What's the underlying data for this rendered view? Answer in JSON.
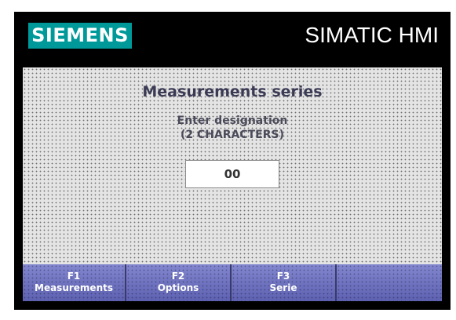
{
  "header": {
    "logo_text": "SIEMENS",
    "product": "SIMATIC HMI"
  },
  "screen": {
    "title": "Measurements series",
    "prompt_line1": "Enter designation",
    "prompt_line2": "(2 CHARACTERS)",
    "input_value": "00"
  },
  "softkeys": [
    {
      "key": "F1",
      "label": "Measurements"
    },
    {
      "key": "F2",
      "label": "Options"
    },
    {
      "key": "F3",
      "label": "Serie"
    },
    {
      "key": "",
      "label": ""
    }
  ],
  "colors": {
    "logo_bg": "#009999",
    "softkey_bg": "#6e72bf",
    "screen_bg": "#e4e4e4"
  }
}
